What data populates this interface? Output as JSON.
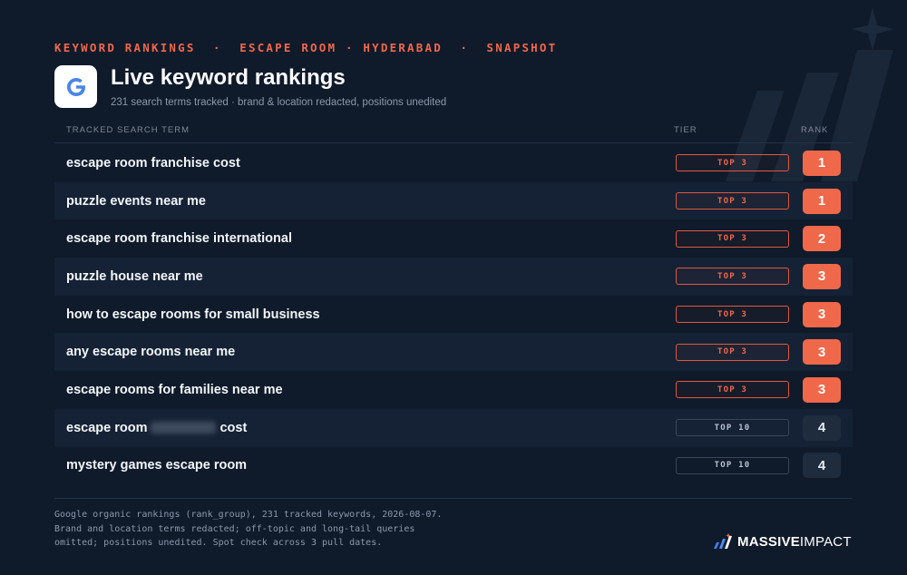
{
  "kicker": {
    "label": "KEYWORD RANKINGS  ·  ESCAPE ROOM · HYDERABAD  ·  SNAPSHOT"
  },
  "header": {
    "logo_icon": "google-g-icon",
    "title": "Live keyword rankings",
    "subtitle": "231 search terms tracked · brand & location redacted, positions unedited"
  },
  "columns": {
    "term": "TRACKED SEARCH TERM",
    "tier": "TIER",
    "rank": "RANK"
  },
  "rows": [
    {
      "term": "escape room franchise cost",
      "term_suffix": "",
      "redacted": false,
      "tier": "TOP 3",
      "rank": "1"
    },
    {
      "term": "puzzle events near me",
      "term_suffix": "",
      "redacted": false,
      "tier": "TOP 3",
      "rank": "1"
    },
    {
      "term": "escape room franchise international",
      "term_suffix": "",
      "redacted": false,
      "tier": "TOP 3",
      "rank": "2"
    },
    {
      "term": "puzzle house near me",
      "term_suffix": "",
      "redacted": false,
      "tier": "TOP 3",
      "rank": "3"
    },
    {
      "term": "how to escape rooms for small business",
      "term_suffix": "",
      "redacted": false,
      "tier": "TOP 3",
      "rank": "3"
    },
    {
      "term": "any escape rooms near me",
      "term_suffix": "",
      "redacted": false,
      "tier": "TOP 3",
      "rank": "3"
    },
    {
      "term": "escape rooms for families near me",
      "term_suffix": "",
      "redacted": false,
      "tier": "TOP 3",
      "rank": "3"
    },
    {
      "term": "escape room",
      "term_suffix": "cost",
      "redacted": true,
      "tier": "TOP 10",
      "rank": "4"
    },
    {
      "term": "mystery games escape room",
      "term_suffix": "",
      "redacted": false,
      "tier": "TOP 10",
      "rank": "4"
    }
  ],
  "footnote": {
    "line1": "Google organic rankings (rank_group), 231 tracked keywords, 2026-08-07.",
    "line2": "Brand and location terms redacted; off-topic and long-tail queries",
    "line3": "omitted; positions unedited. Spot check across 3 pull dates."
  },
  "brand": {
    "icon": "massive-impact-logo-icon",
    "name_bold": "MASSIVE",
    "name_light": "IMPACT"
  },
  "colors": {
    "background": "#0f1a2a",
    "accent": "#f0684a",
    "muted": "#8d98ab"
  }
}
